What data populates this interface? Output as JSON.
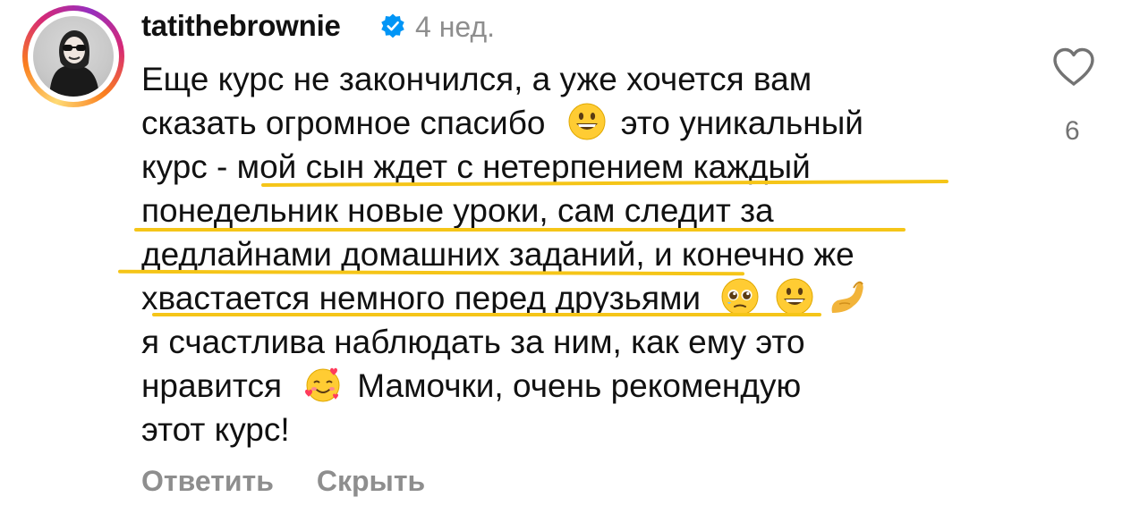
{
  "comment": {
    "username": "tatithebrownie",
    "time": "4 нед.",
    "lines": [
      "Еще курс не закончился, а уже хочется вам",
      "сказать огромное спасибо",
      "это уникальный",
      "курс - мой сын ждет с нетерпением каждый",
      "понедельник новые уроки, сам следит за",
      "дедлайнами домашних заданий,  и конечно же",
      "хвастается немного перед друзьями",
      "я счастлива наблюдать за ним, как ему это",
      "нравится",
      "Мамочки, очень рекомендую",
      "этот курс!"
    ],
    "like_count": "6",
    "reply_label": "Ответить",
    "hide_label": "Скрыть"
  },
  "icons": {
    "verified": "verified-badge-icon",
    "like": "heart-outline-icon",
    "emoji_grin": "grinning-face-emoji",
    "emoji_pleading": "pleading-face-emoji",
    "emoji_pinch": "pinching-hand-emoji",
    "emoji_hearts": "smiling-face-with-hearts-emoji"
  },
  "colors": {
    "verified_blue": "#0095f6",
    "underline_yellow": "#f5c518",
    "muted_gray": "#8e8e8e"
  }
}
